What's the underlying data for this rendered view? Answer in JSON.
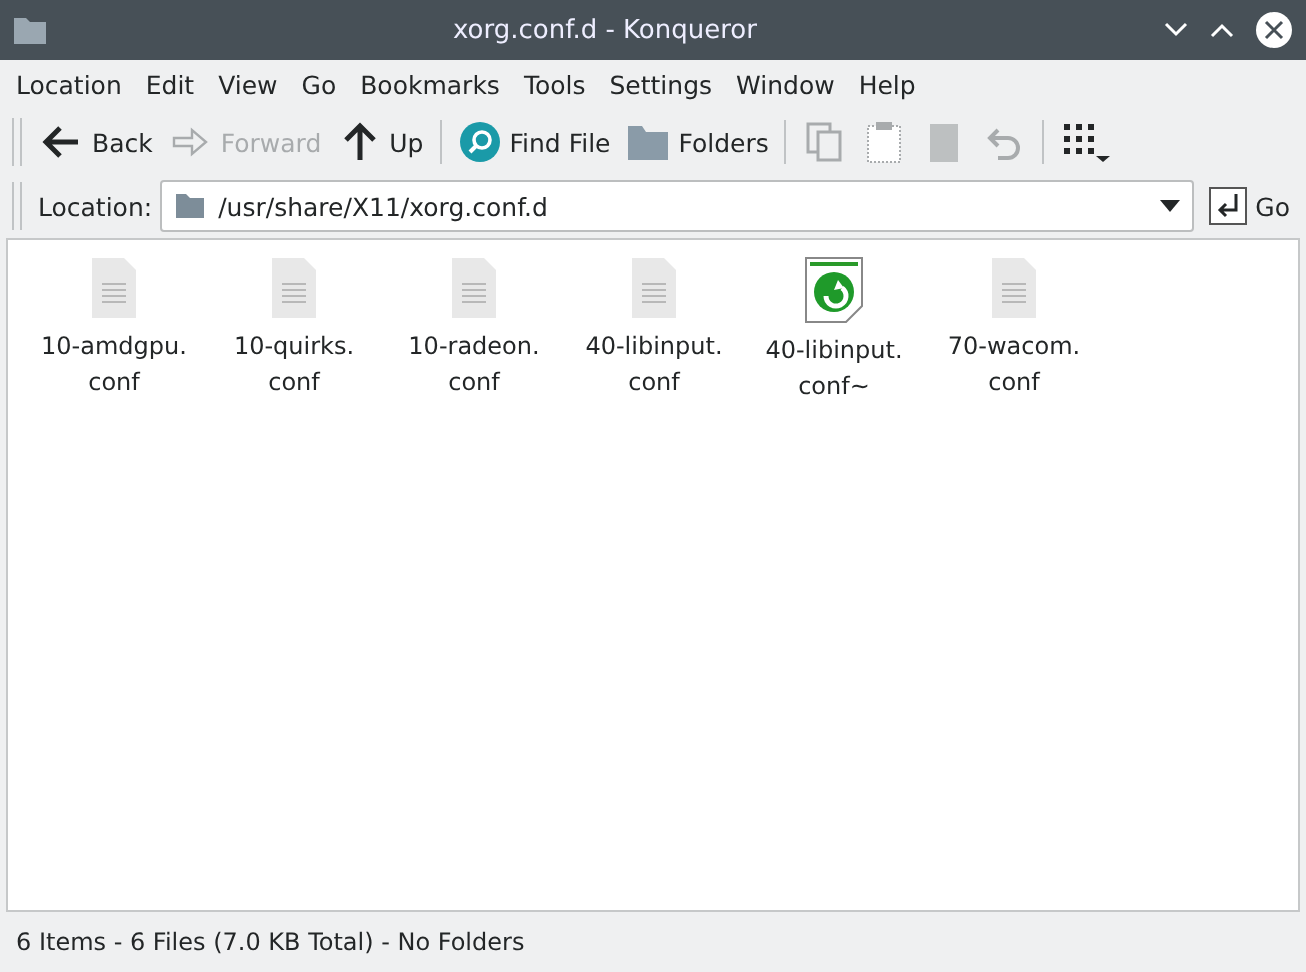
{
  "window": {
    "title": "xorg.conf.d - Konqueror"
  },
  "menu": [
    "Location",
    "Edit",
    "View",
    "Go",
    "Bookmarks",
    "Tools",
    "Settings",
    "Window",
    "Help"
  ],
  "toolbar": [
    {
      "kind": "back",
      "label": "Back",
      "disabled": false
    },
    {
      "kind": "forward",
      "label": "Forward",
      "disabled": true
    },
    {
      "kind": "up",
      "label": "Up",
      "disabled": false
    },
    {
      "kind": "sep"
    },
    {
      "kind": "find",
      "label": "Find File",
      "disabled": false
    },
    {
      "kind": "folders",
      "label": "Folders",
      "disabled": false
    },
    {
      "kind": "sep"
    },
    {
      "kind": "copy",
      "disabled": true
    },
    {
      "kind": "paste",
      "disabled": true
    },
    {
      "kind": "delete",
      "disabled": true
    },
    {
      "kind": "undo",
      "disabled": true
    },
    {
      "kind": "sep"
    },
    {
      "kind": "view",
      "disabled": false
    }
  ],
  "location": {
    "label": "Location:",
    "value": "/usr/share/X11/xorg.conf.d",
    "go": "Go"
  },
  "files": [
    {
      "name": "10-amdgpu.",
      "ext": "conf",
      "kind": "text"
    },
    {
      "name": "10-quirks.",
      "ext": "conf",
      "kind": "text"
    },
    {
      "name": "10-radeon.",
      "ext": "conf",
      "kind": "text"
    },
    {
      "name": "40-libinput.",
      "ext": "conf",
      "kind": "text"
    },
    {
      "name": "40-libinput.",
      "ext": "conf~",
      "kind": "backup"
    },
    {
      "name": "70-wacom.",
      "ext": "conf",
      "kind": "text"
    }
  ],
  "status_bar": "6 Items - 6 Files (7.0 KB Total) - No Folders"
}
